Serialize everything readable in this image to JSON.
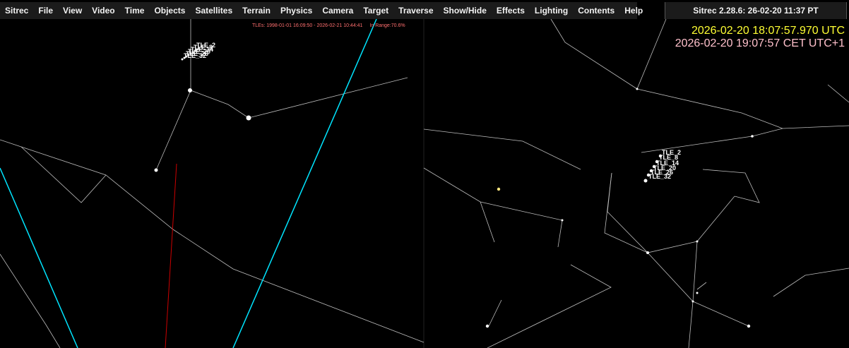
{
  "menu": [
    "Sitrec",
    "File",
    "View",
    "Video",
    "Time",
    "Objects",
    "Satellites",
    "Terrain",
    "Physics",
    "Camera",
    "Target",
    "Traverse",
    "Show/Hide",
    "Effects",
    "Lighting",
    "Contents",
    "Help"
  ],
  "version": "Sitrec 2.28.6: 26-02-20 11:37 PT",
  "utc_time": "2026-02-20 18:07:57.970 UTC",
  "local_time": "2026-02-20 19:07:57 CET UTC+1",
  "tle_range": "TLEs: 1998-01-01 16:09:50 - 2026-02-21 10:44:41",
  "in_range": "In Range:70.6%",
  "left_sat_labels": [
    "TLE_2",
    "TLE_8",
    "TLE_14",
    "TLE_20",
    "TLE_26",
    "TLE_32"
  ],
  "right_sat_labels": [
    "TLE_2",
    "TLE_8",
    "TLE_14",
    "TLE_20",
    "TLE_26",
    "TLE_32"
  ],
  "colors": {
    "utc": "#ffff33",
    "local": "#ffc0cb",
    "orbit": "#00e5ff",
    "track": "#cc0000",
    "tle_info": "#ff6f6f"
  }
}
